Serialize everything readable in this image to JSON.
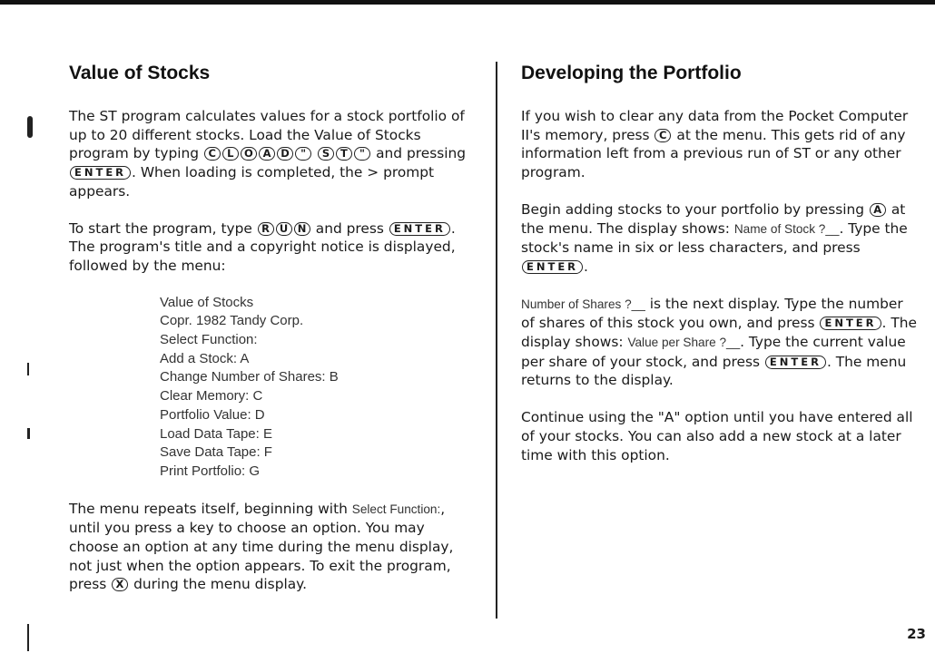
{
  "left": {
    "heading": "Value of Stocks",
    "p1": {
      "a": "The ST program calculates values for a stock portfolio of up to 20 different stocks. Load the Value of Stocks program by typing",
      "keys_cload": [
        "C",
        "L",
        "O",
        "A",
        "D",
        "\""
      ],
      "keys_st": [
        "S",
        "T",
        "\""
      ],
      "b": "and pressing",
      "enter": "ENTER",
      "c": ". When loading is completed, the > prompt appears."
    },
    "p2": {
      "a": "To start the program, type",
      "keys_run": [
        "R",
        "U",
        "N"
      ],
      "b": "and press",
      "enter": "ENTER",
      "c": ". The program's title and a copyright notice is displayed, followed by the menu:"
    },
    "menu": [
      "Value of Stocks",
      "Copr. 1982 Tandy Corp.",
      "Select Function:",
      "Add a Stock: A",
      "Change Number of Shares: B",
      "Clear Memory: C",
      "Portfolio Value: D",
      "Load Data Tape: E",
      "Save Data Tape: F",
      "Print Portfolio: G"
    ],
    "p3": {
      "a": "The menu repeats itself, beginning with",
      "lcd": "Select Function:",
      "b": ", until you press a key to choose an option. You may choose an option at any time during the menu display, not just when the option appears. To exit the program, press",
      "key_x": "X",
      "c": "during the menu display."
    }
  },
  "right": {
    "heading": "Developing the Portfolio",
    "p1": {
      "a": "If you wish to clear any data from the Pocket Computer II's memory, press",
      "key_c": "C",
      "b": "at the menu. This gets rid of any information left from a previous run of ST or any other program."
    },
    "p2": {
      "a": "Begin adding stocks to your portfolio by pressing",
      "key_a": "A",
      "b": "at the menu. The display shows:",
      "lcd": "Name of Stock ?__",
      "c": ". Type the stock's name in six or less characters, and press",
      "enter": "ENTER",
      "d": "."
    },
    "p3": {
      "lcd1": "Number of Shares ?__",
      "a": "is the next display. Type the number of shares of this stock you own, and press",
      "enter1": "ENTER",
      "b": ". The display shows:",
      "lcd2": "Value per Share ?__",
      "c": ". Type the current value per share of your stock, and press",
      "enter2": "ENTER",
      "d": ". The menu returns to the display."
    },
    "p4": "Continue using the \"A\" option until you have entered all of your stocks. You can also add a new stock at a later time with this option."
  },
  "page_number": "23"
}
